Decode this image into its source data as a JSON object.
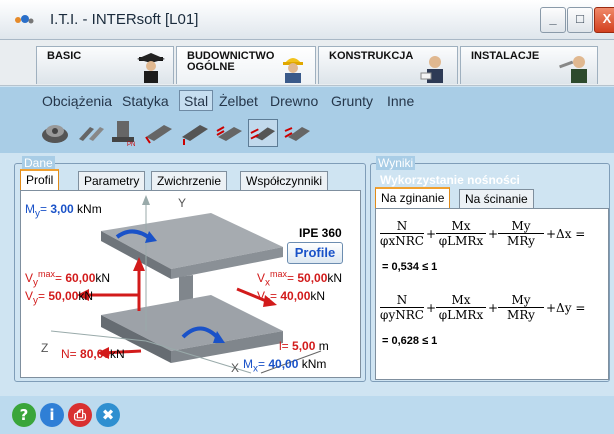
{
  "window": {
    "title": "I.T.I. - INTERsoft [L01]",
    "minimize_glyph": "_",
    "maximize_glyph": "□",
    "close_glyph": "X"
  },
  "modules": [
    {
      "label": "BASIC",
      "icon": "graduate-icon"
    },
    {
      "label": "BUDOWNICTWO OGÓLNE",
      "line1": "BUDOWNICTWO",
      "line2": "OGÓLNE",
      "icon": "builder-icon"
    },
    {
      "label": "KONSTRUKCJA",
      "icon": "engineer-icon"
    },
    {
      "label": "INSTALACJE",
      "icon": "wrench-person-icon"
    }
  ],
  "submenu": [
    "Obciążenia",
    "Statyka",
    "Stal",
    "Żelbet",
    "Drewno",
    "Grunty",
    "Inne"
  ],
  "submenu_selected": "Stal",
  "toolbar_icons": [
    "bolt-connection-icon",
    "steel-beam-joint-icon",
    "column-base-icon",
    "beam-icon",
    "beam-joint-icon",
    "beam-load-icon",
    "beam-bending-icon",
    "beam-shear-icon"
  ],
  "dane": {
    "legend": "Dane",
    "tabs": [
      "Profil",
      "Parametry",
      "Zwichrzenie",
      "Współczynniki"
    ],
    "active_tab": "Profil",
    "profile_name": "IPE 360",
    "profile_button": "Profile",
    "labels": {
      "my_sym": "M",
      "my_sub": "y",
      "my_val": "3,00",
      "my_unit": "kNm",
      "vymax_sym": "V",
      "vymax_sub": "y",
      "vymax_sup": "max",
      "vymax_val": "60,00",
      "vymax_unit": "kN",
      "vy_sym": "V",
      "vy_sub": "y",
      "vy_val": "50,00",
      "vy_unit": "kN",
      "vxmax_sym": "V",
      "vxmax_sub": "x",
      "vxmax_sup": "max",
      "vxmax_val": "50,00",
      "vxmax_unit": "kN",
      "vx_sym": "V",
      "vx_sub": "x",
      "vx_val": "40,00",
      "vx_unit": "kN",
      "n_sym": "N",
      "n_val": "80,00",
      "n_unit": "kN",
      "l_sym": "l",
      "l_val": "5,00",
      "l_unit": "m",
      "mx_sym": "M",
      "mx_sub": "x",
      "mx_val": "40,00",
      "mx_unit": "kNm",
      "axis_y": "Y",
      "axis_z": "Z",
      "axis_x": "X"
    }
  },
  "wyniki": {
    "legend": "Wyniki",
    "title": "Wykorzystanie nośności",
    "tabs": [
      "Na zginanie",
      "Na ścinanie"
    ],
    "active_tab": "Na zginanie",
    "formula_x": {
      "t1_num": "N",
      "t1_den": "φxNRC",
      "t2_num": "Mx",
      "t2_den": "φLMRx",
      "t3_num": "My",
      "t3_den": "MRy",
      "tail": "+Δx =",
      "result": "= 0,534 ≤ 1"
    },
    "formula_y": {
      "t1_num": "N",
      "t1_den": "φyNRC",
      "t2_num": "Mx",
      "t2_den": "φLMRx",
      "t3_num": "My",
      "t3_den": "MRy",
      "tail": "+Δy =",
      "result": "= 0,628 ≤ 1"
    }
  },
  "bottom_icons": [
    {
      "name": "help-icon",
      "glyph": "?",
      "color": "#3aa53a"
    },
    {
      "name": "info-icon",
      "glyph": "i",
      "color": "#2f7fd6"
    },
    {
      "name": "print-icon",
      "glyph": "⎙",
      "color": "#d93030"
    },
    {
      "name": "tools-icon",
      "glyph": "✖",
      "color": "#2f8fd0"
    }
  ],
  "colors": {
    "accent_blue": "#1a52c8",
    "accent_red": "#d21b1b",
    "toolbar_bg": "#a9cde6",
    "tab_active_border": "#f0a030"
  }
}
